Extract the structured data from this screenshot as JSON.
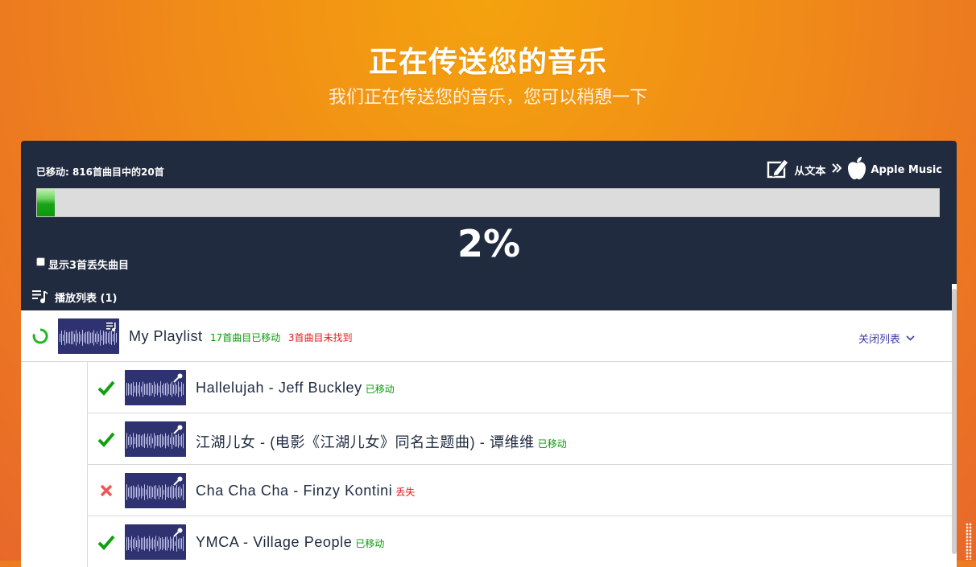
{
  "hero": {
    "title": "正在传送您的音乐",
    "subtitle": "我们正在传送您的音乐，您可以稍憩一下"
  },
  "transfer": {
    "moved_text": "已移动: 816首曲目中的20首",
    "source_label": "从文本",
    "source_icon": "edit-text-icon",
    "destination_label": "Apple Music",
    "destination_icon": "apple-logo-icon",
    "progress_fraction": 0.02,
    "percent_label": "2%",
    "show_missing_label": "显示3首丢失曲目",
    "show_missing_checked": false
  },
  "playlists_header": {
    "label": "播放列表 (1)",
    "icon": "playlist-icon"
  },
  "playlist": {
    "name": "My Playlist",
    "moved_summary": "17首曲目已移动",
    "missing_summary": "3首曲目未找到",
    "close_label": "关闭列表",
    "status_icon": "loading-spinner-icon"
  },
  "tracks": [
    {
      "title": "Hallelujah - Jeff Buckley",
      "status": "moved",
      "status_label": "已移动"
    },
    {
      "title": "江湖儿女 - (电影《江湖儿女》同名主题曲) - 谭维维",
      "status": "moved",
      "status_label": "已移动"
    },
    {
      "title": "Cha Cha Cha - Finzy Kontini",
      "status": "missing",
      "status_label": "丢失"
    },
    {
      "title": "YMCA - Village People",
      "status": "moved",
      "status_label": "已移动"
    }
  ],
  "colors": {
    "background_top": "#f4a20e",
    "background_bottom": "#e8682a",
    "panel": "#212b40",
    "progress_fill": "#1aa31a",
    "moved": "#0a9a0a",
    "missing": "#e01b1b",
    "link": "#3d3ba8"
  }
}
